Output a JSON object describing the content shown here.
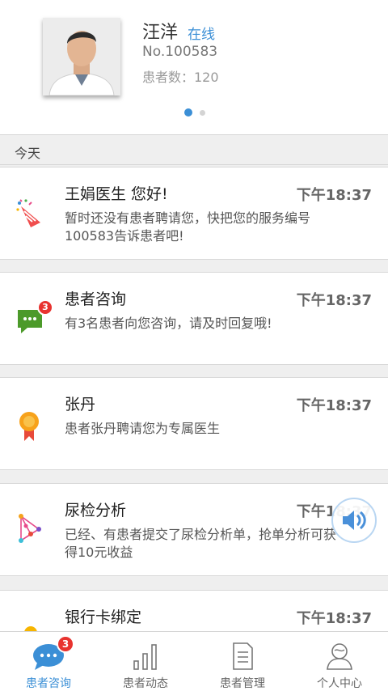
{
  "profile": {
    "name": "汪洋",
    "status": "在线",
    "doctor_no": "No.100583",
    "patients": "患者数：120"
  },
  "section": {
    "label": "今天"
  },
  "cards": [
    {
      "title": "王娟医生 您好!",
      "time": "下午18:37",
      "desc": "暂时还没有患者聘请您，快把您的服务编号100583告诉患者吧!",
      "icon": "party-popper-icon"
    },
    {
      "title": "患者咨询",
      "time": "下午18:37",
      "desc": "有3名患者向您咨询，请及时回复哦!",
      "icon": "chat-icon",
      "badge": "3"
    },
    {
      "title": "张丹",
      "time": "下午18:37",
      "desc": "患者张丹聘请您为专属医生",
      "icon": "award-ribbon-icon"
    },
    {
      "title": "尿检分析",
      "time": "下午18:37",
      "desc": "已经、有患者提交了尿检分析单，抢单分析可获得10元收益",
      "icon": "molecule-icon"
    },
    {
      "title": "银行卡绑定",
      "time": "下午18:37",
      "desc": "",
      "icon": "coin-icon"
    }
  ],
  "tabs": [
    {
      "label": "患者咨询",
      "icon": "chat-bubble-icon",
      "badge": "3",
      "active": true
    },
    {
      "label": "患者动态",
      "icon": "bar-chart-icon"
    },
    {
      "label": "患者管理",
      "icon": "document-icon"
    },
    {
      "label": "个人中心",
      "icon": "person-icon"
    }
  ],
  "colors": {
    "accent": "#3b8fd6",
    "badge": "#e8332f",
    "chat_green": "#4c9a2a"
  }
}
